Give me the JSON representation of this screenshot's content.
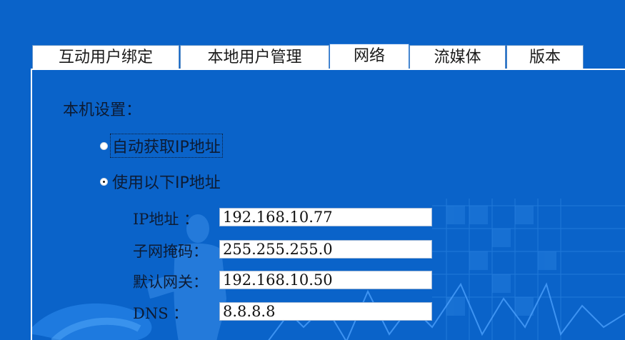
{
  "tabs": [
    {
      "label": "互动用户绑定"
    },
    {
      "label": "本地用户管理"
    },
    {
      "label": "网络",
      "active": true
    },
    {
      "label": "流媒体"
    },
    {
      "label": "版本"
    }
  ],
  "network": {
    "section_title": "本机设置：",
    "options": [
      {
        "label": "自动获取IP地址",
        "selected": false
      },
      {
        "label": "使用以下IP地址",
        "selected": true
      }
    ],
    "fields": [
      {
        "label": "IP地址 ：",
        "value": "192.168.10.77"
      },
      {
        "label": "子网掩码：",
        "value": "255.255.255.0"
      },
      {
        "label": "默认网关：",
        "value": "192.168.10.50"
      },
      {
        "label": "DNS  ：",
        "value": "8.8.8.8"
      }
    ]
  },
  "colors": {
    "background": "#0a63c9",
    "tab": "#ffffff",
    "text": "#0d1b33"
  }
}
